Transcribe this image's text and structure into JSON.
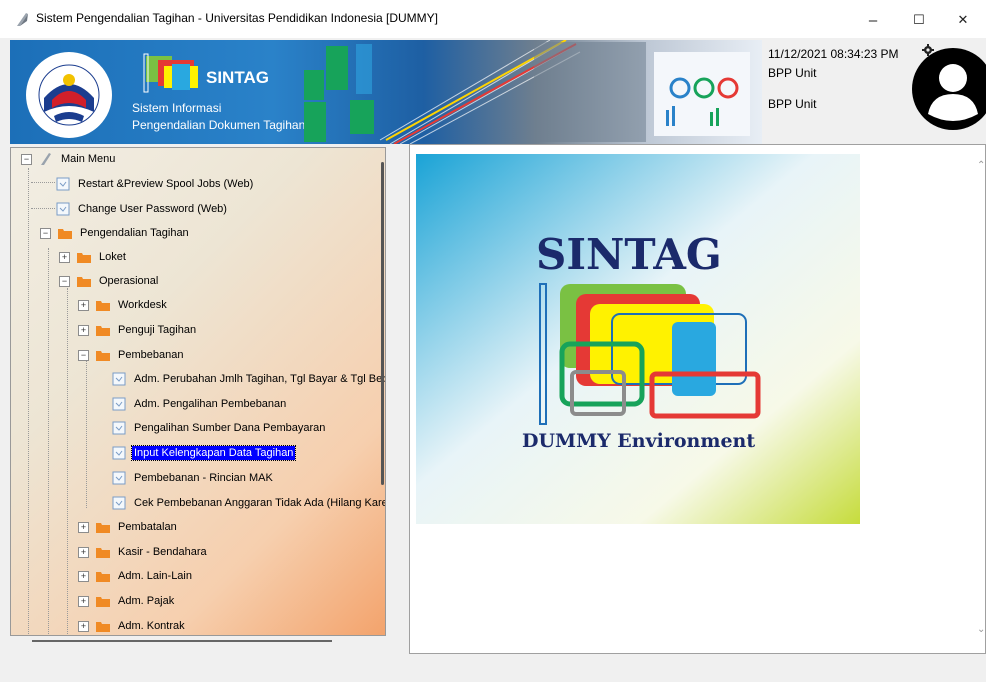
{
  "window": {
    "title": "Sistem Pengendalian Tagihan - Universitas Pendidikan Indonesia [DUMMY]",
    "minimize": "–",
    "maximize": "☐",
    "close": "✕"
  },
  "banner": {
    "app_name": "SINTAG",
    "subtitle_line1": "Sistem Informasi",
    "subtitle_line2": "Pengendalian Dokumen Tagihan"
  },
  "user_info": {
    "datetime": "11/12/2021 08:34:23 PM",
    "unit_line1": "BPP Unit",
    "unit_line2": "BPP Unit"
  },
  "tree": {
    "items": [
      {
        "label": "Main Menu"
      },
      {
        "label": "Restart &Preview Spool Jobs (Web)"
      },
      {
        "label": "Change User Password (Web)"
      },
      {
        "label": "Pengendalian Tagihan"
      },
      {
        "label": "Loket"
      },
      {
        "label": "Operasional"
      },
      {
        "label": "Workdesk"
      },
      {
        "label": "Penguji Tagihan"
      },
      {
        "label": "Pembebanan"
      },
      {
        "label": "Adm. Perubahan Jmlh Tagihan, Tgl Bayar & Tgl Beba"
      },
      {
        "label": "Adm. Pengalihan Pembebanan"
      },
      {
        "label": "Pengalihan Sumber Dana Pembayaran"
      },
      {
        "label": "Input Kelengkapan Data Tagihan"
      },
      {
        "label": "Pembebanan - Rincian MAK"
      },
      {
        "label": "Cek Pembebanan Anggaran Tidak Ada (Hilang Karen"
      },
      {
        "label": "Pembatalan"
      },
      {
        "label": "Kasir - Bendahara"
      },
      {
        "label": "Adm. Lain-Lain"
      },
      {
        "label": "Adm. Pajak"
      },
      {
        "label": "Adm. Kontrak"
      }
    ]
  },
  "splash": {
    "title": "SINTAG",
    "environment": "DUMMY Environment"
  },
  "colors": {
    "selection": "#0000ff",
    "folder": "#f08a24",
    "splash_text": "#1b2a6b"
  },
  "icons": {
    "app": "feather-icon",
    "folder": "folder-icon",
    "item": "document-icon",
    "settings": "gear-icon",
    "user": "user-avatar-icon"
  }
}
